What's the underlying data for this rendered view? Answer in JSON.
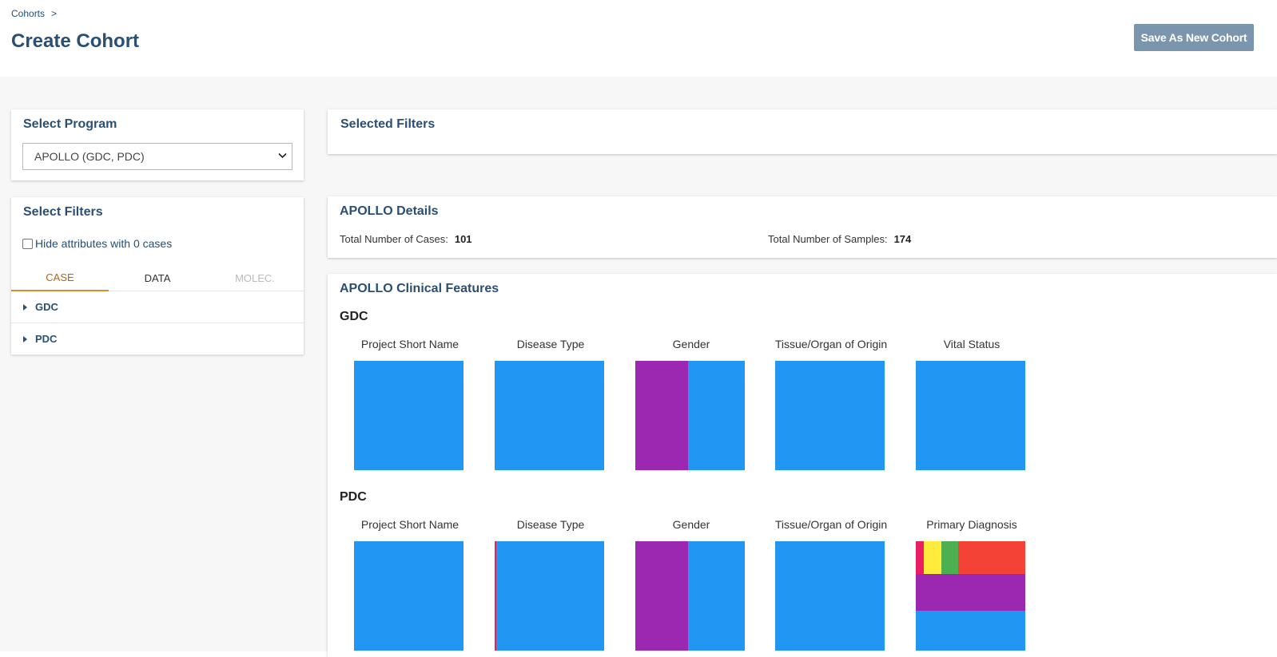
{
  "breadcrumb": {
    "link": "Cohorts",
    "separator": ">"
  },
  "page_title": "Create Cohort",
  "save_button": "Save As New Cohort",
  "program": {
    "title": "Select Program",
    "selected": "APOLLO (GDC, PDC)"
  },
  "filters": {
    "title": "Select Filters",
    "hide_zero_label": "Hide attributes with 0 cases",
    "hide_zero_checked": false,
    "tabs": [
      {
        "label": "CASE",
        "state": "active"
      },
      {
        "label": "DATA",
        "state": "normal"
      },
      {
        "label": "MOLEC.",
        "state": "disabled"
      }
    ],
    "groups": [
      "GDC",
      "PDC"
    ]
  },
  "selected_filters": {
    "title": "Selected Filters"
  },
  "details": {
    "title": "APOLLO Details",
    "cases_label": "Total Number of Cases:",
    "cases_value": "101",
    "samples_label": "Total Number of Samples:",
    "samples_value": "174"
  },
  "clinical": {
    "title": "APOLLO Clinical Features",
    "colors": {
      "blue": "#2196f3",
      "purple": "#9c27b0",
      "pink": "#e91e63",
      "yellow": "#ffeb3b",
      "green": "#4caf50",
      "red": "#f44336"
    },
    "groups": [
      {
        "name": "GDC",
        "charts": [
          {
            "title": "Project Short Name",
            "segments": []
          },
          {
            "title": "Disease Type",
            "segments": []
          },
          {
            "title": "Gender",
            "segments": []
          },
          {
            "title": "Tissue/Organ of Origin",
            "segments": []
          },
          {
            "title": "Vital Status",
            "segments": []
          }
        ]
      },
      {
        "name": "PDC",
        "charts": [
          {
            "title": "Project Short Name",
            "segments": []
          },
          {
            "title": "Disease Type",
            "segments": []
          },
          {
            "title": "Gender",
            "segments": []
          },
          {
            "title": "Tissue/Organ of Origin",
            "segments": []
          },
          {
            "title": "Primary Diagnosis",
            "segments": []
          }
        ]
      }
    ]
  }
}
